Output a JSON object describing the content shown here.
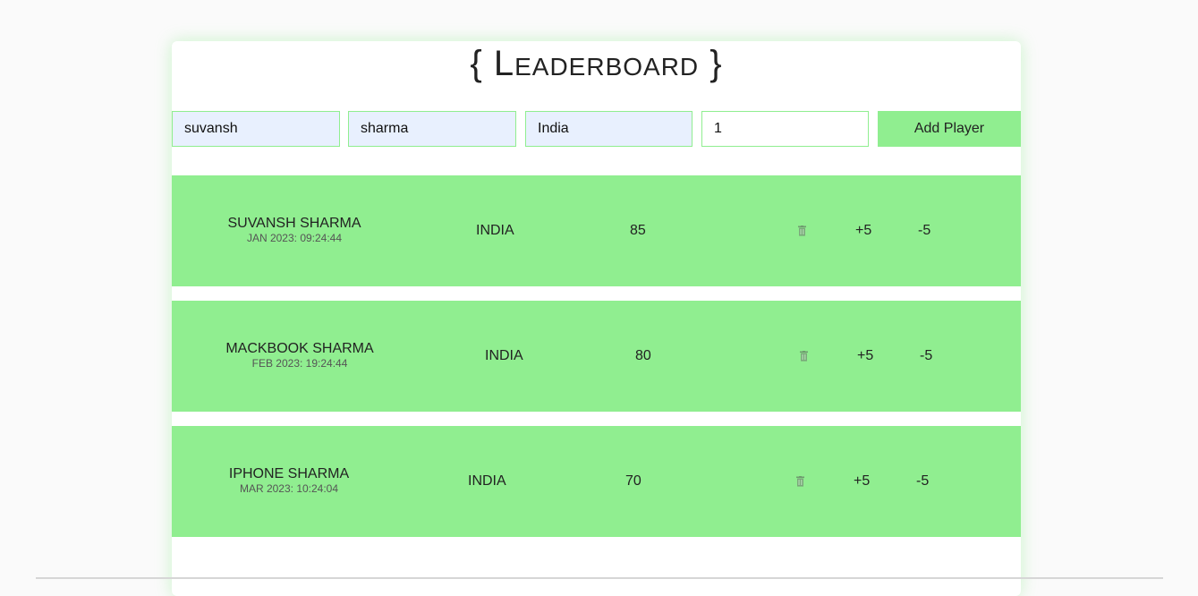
{
  "title": "{ Leaderboard }",
  "form": {
    "first_name": "suvansh",
    "last_name": "sharma",
    "country": "India",
    "score": "1",
    "add_label": "Add Player"
  },
  "players": [
    {
      "name": "SUVANSH SHARMA",
      "date": "JAN 2023: 09:24:44",
      "country": "INDIA",
      "score": "85",
      "plus": "+5",
      "minus": "-5"
    },
    {
      "name": "MACKBOOK SHARMA",
      "date": "FEB 2023: 19:24:44",
      "country": "INDIA",
      "score": "80",
      "plus": "+5",
      "minus": "-5"
    },
    {
      "name": "IPHONE SHARMA",
      "date": "MAR 2023: 10:24:04",
      "country": "INDIA",
      "score": "70",
      "plus": "+5",
      "minus": "-5"
    }
  ],
  "colors": {
    "accent": "#90ee90",
    "autofill": "#e8f0fe"
  },
  "icons": {
    "delete": "trash-icon"
  }
}
